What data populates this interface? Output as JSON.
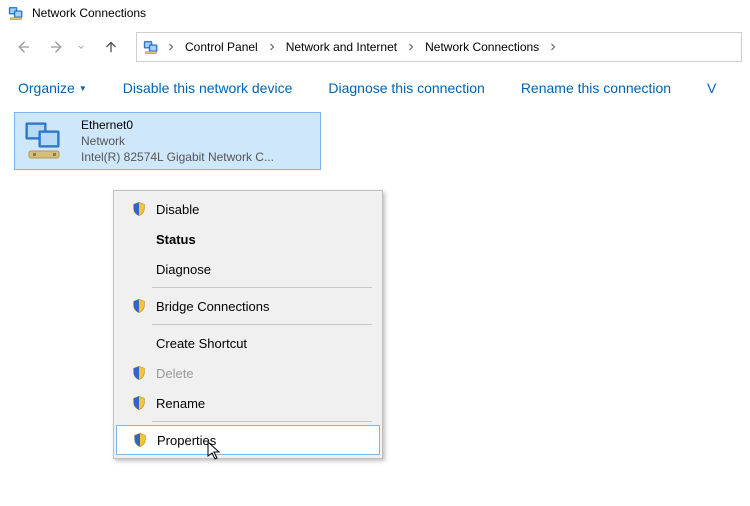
{
  "window": {
    "title": "Network Connections"
  },
  "breadcrumb": {
    "seg1": "Control Panel",
    "seg2": "Network and Internet",
    "seg3": "Network Connections"
  },
  "toolbar": {
    "organize": "Organize",
    "disable": "Disable this network device",
    "diagnose": "Diagnose this connection",
    "rename": "Rename this connection",
    "view_cut": "V"
  },
  "adapter": {
    "name": "Ethernet0",
    "status": "Network",
    "device": "Intel(R) 82574L Gigabit Network C..."
  },
  "contextmenu": {
    "disable": "Disable",
    "status": "Status",
    "diagnose": "Diagnose",
    "bridge": "Bridge Connections",
    "shortcut": "Create Shortcut",
    "delete": "Delete",
    "rename": "Rename",
    "properties": "Properties"
  }
}
